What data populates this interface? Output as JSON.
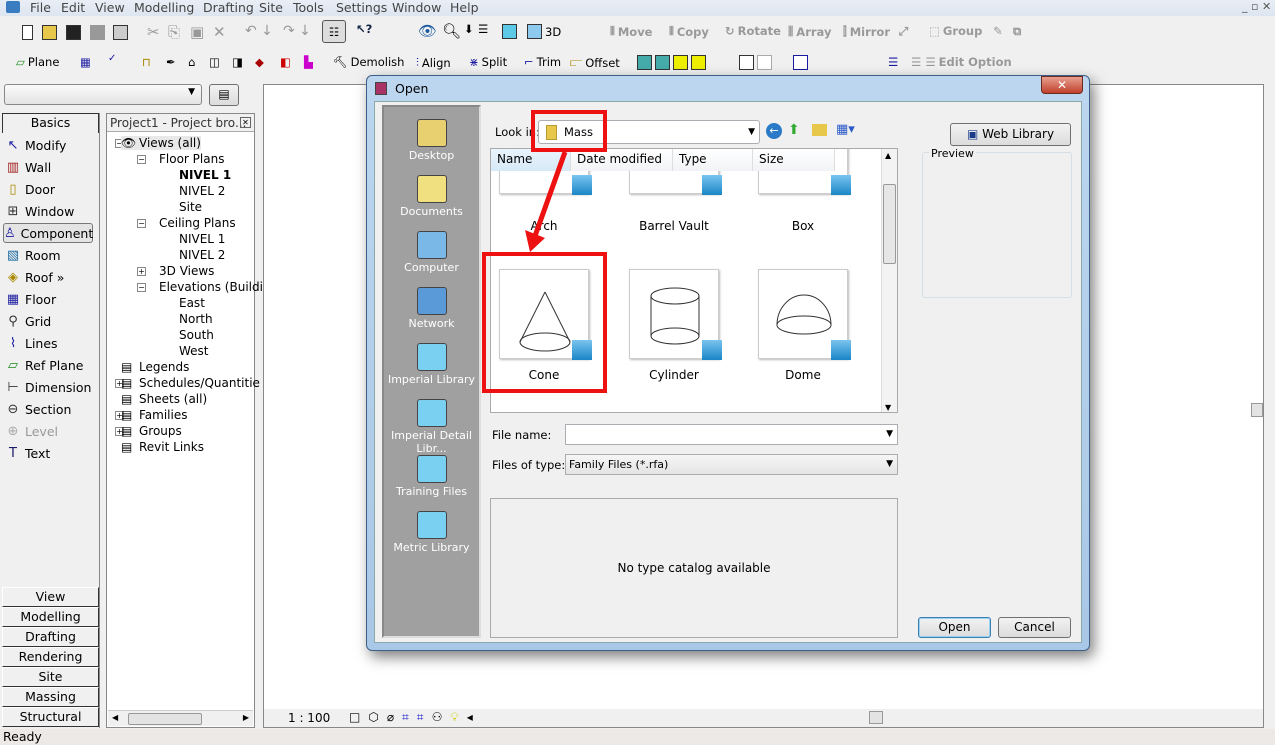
{
  "menu": [
    "File",
    "Edit",
    "View",
    "Modelling",
    "Drafting",
    "Site",
    "Tools",
    "Settings",
    "Window",
    "Help"
  ],
  "toolbar1": {
    "view_3d": "3D",
    "move": "Move",
    "copy": "Copy",
    "rotate": "Rotate",
    "array": "Array",
    "mirror": "Mirror",
    "group": "Group"
  },
  "toolbar2": {
    "plane": "Plane",
    "demolish": "Demolish",
    "align": "Align",
    "split": "Split",
    "trim": "Trim",
    "offset": "Offset",
    "edit_option": "Edit Option"
  },
  "design_bar": {
    "active_tab": "Basics",
    "items": [
      "Modify",
      "Wall",
      "Door",
      "Window",
      "Component",
      "Room",
      "Roof »",
      "Floor",
      "Grid",
      "Lines",
      "Ref Plane",
      "Dimension",
      "Section",
      "Level",
      "Text"
    ],
    "tabs": [
      "View",
      "Modelling",
      "Drafting",
      "Rendering",
      "Site",
      "Massing",
      "Structural"
    ]
  },
  "project_browser": {
    "title": "Project1 - Project bro...",
    "nodes": [
      {
        "label": "Views (all)",
        "level": 0,
        "toggle": "-"
      },
      {
        "label": "Floor Plans",
        "level": 1,
        "toggle": "-"
      },
      {
        "label": "NIVEL 1",
        "level": 2,
        "bold": true
      },
      {
        "label": "NIVEL 2",
        "level": 2
      },
      {
        "label": "Site",
        "level": 2
      },
      {
        "label": "Ceiling Plans",
        "level": 1,
        "toggle": "-"
      },
      {
        "label": "NIVEL 1",
        "level": 2
      },
      {
        "label": "NIVEL 2",
        "level": 2
      },
      {
        "label": "3D Views",
        "level": 1,
        "toggle": "+"
      },
      {
        "label": "Elevations (Building",
        "level": 1,
        "toggle": "-"
      },
      {
        "label": "East",
        "level": 2
      },
      {
        "label": "North",
        "level": 2
      },
      {
        "label": "South",
        "level": 2
      },
      {
        "label": "West",
        "level": 2
      },
      {
        "label": "Legends",
        "level": 0
      },
      {
        "label": "Schedules/Quantitie",
        "level": 0,
        "toggle": "+"
      },
      {
        "label": "Sheets (all)",
        "level": 0
      },
      {
        "label": "Families",
        "level": 0,
        "toggle": "+"
      },
      {
        "label": "Groups",
        "level": 0,
        "toggle": "+"
      },
      {
        "label": "Revit Links",
        "level": 0
      }
    ]
  },
  "view_bar": {
    "scale": "1 : 100"
  },
  "status": "Ready",
  "dialog": {
    "title": "Open",
    "look_in_label": "Look in:",
    "look_in_value": "Mass",
    "web_library": "Web Library",
    "preview_label": "Preview",
    "places": [
      "Desktop",
      "Documents",
      "Computer",
      "Network",
      "Imperial Library",
      "Imperial Detail Libr...",
      "Training Files",
      "Metric Library"
    ],
    "columns": [
      "Name",
      "Date modified",
      "Type",
      "Size"
    ],
    "files": [
      "Arch",
      "Barrel Vault",
      "Box",
      "Cone",
      "Cylinder",
      "Dome"
    ],
    "file_name_label": "File name:",
    "file_name_value": "",
    "files_of_type_label": "Files of type:",
    "files_of_type_value": "Family Files (*.rfa)",
    "catalog_message": "No type catalog available",
    "open": "Open",
    "cancel": "Cancel"
  },
  "colors": {
    "highlight": "#ee1111",
    "places_bg": "#a0a0a0"
  }
}
